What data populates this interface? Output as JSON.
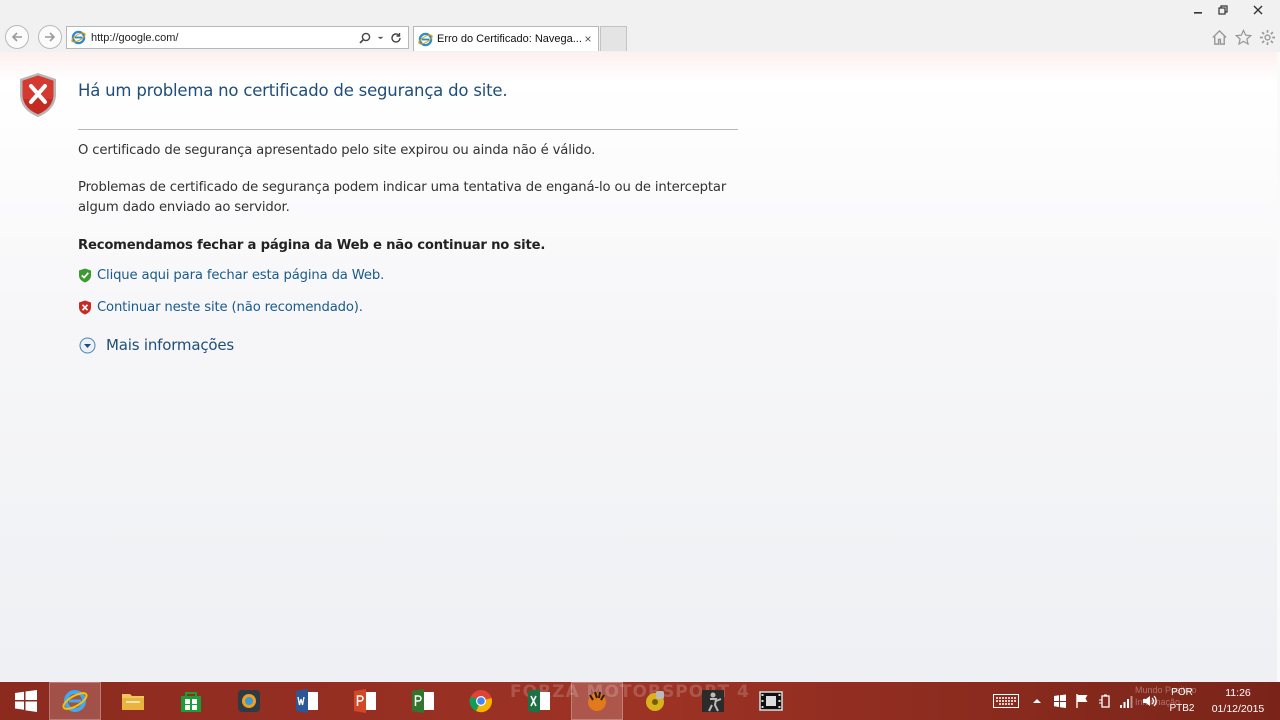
{
  "browser": {
    "address": "http://google.com/",
    "tab_title": "Erro do Certificado: Navega...",
    "tab_close": "×"
  },
  "page": {
    "title": "Há um problema no certificado de segurança do site.",
    "para1": "O certificado de segurança apresentado pelo site expirou ou ainda não é válido.",
    "para2_line1": "Problemas de certificado de segurança podem indicar uma tentativa de enganá-lo ou de interceptar",
    "para2_line2": "algum dado enviado ao servidor.",
    "recommend": "Recomendamos fechar a página da Web e não continuar no site.",
    "close_link": "Clique aqui para fechar esta página da Web.",
    "continue_link": "Continuar neste site (não recomendado).",
    "more_info": "Mais informações"
  },
  "taskbar": {
    "watermark": "FORZA MOTORSPORT 4",
    "language_line1": "POR",
    "language_line2": "PTB2",
    "time": "11:26",
    "date": "01/12/2015",
    "ghost_line1": "Mundo Positivo",
    "ghost_line2": "Informação",
    "apps": [
      "windows-start",
      "internet-explorer",
      "file-explorer",
      "store",
      "chrome-like",
      "word",
      "powerpoint",
      "project",
      "chrome",
      "excel",
      "game",
      "media",
      "counter-strike",
      "video"
    ]
  },
  "colors": {
    "title_blue": "#1f4e79",
    "link_blue": "#1a5a8c",
    "taskbar_red": "#9d3325",
    "shield_red": "#c0392b",
    "shield_green": "#3c9a2f"
  }
}
